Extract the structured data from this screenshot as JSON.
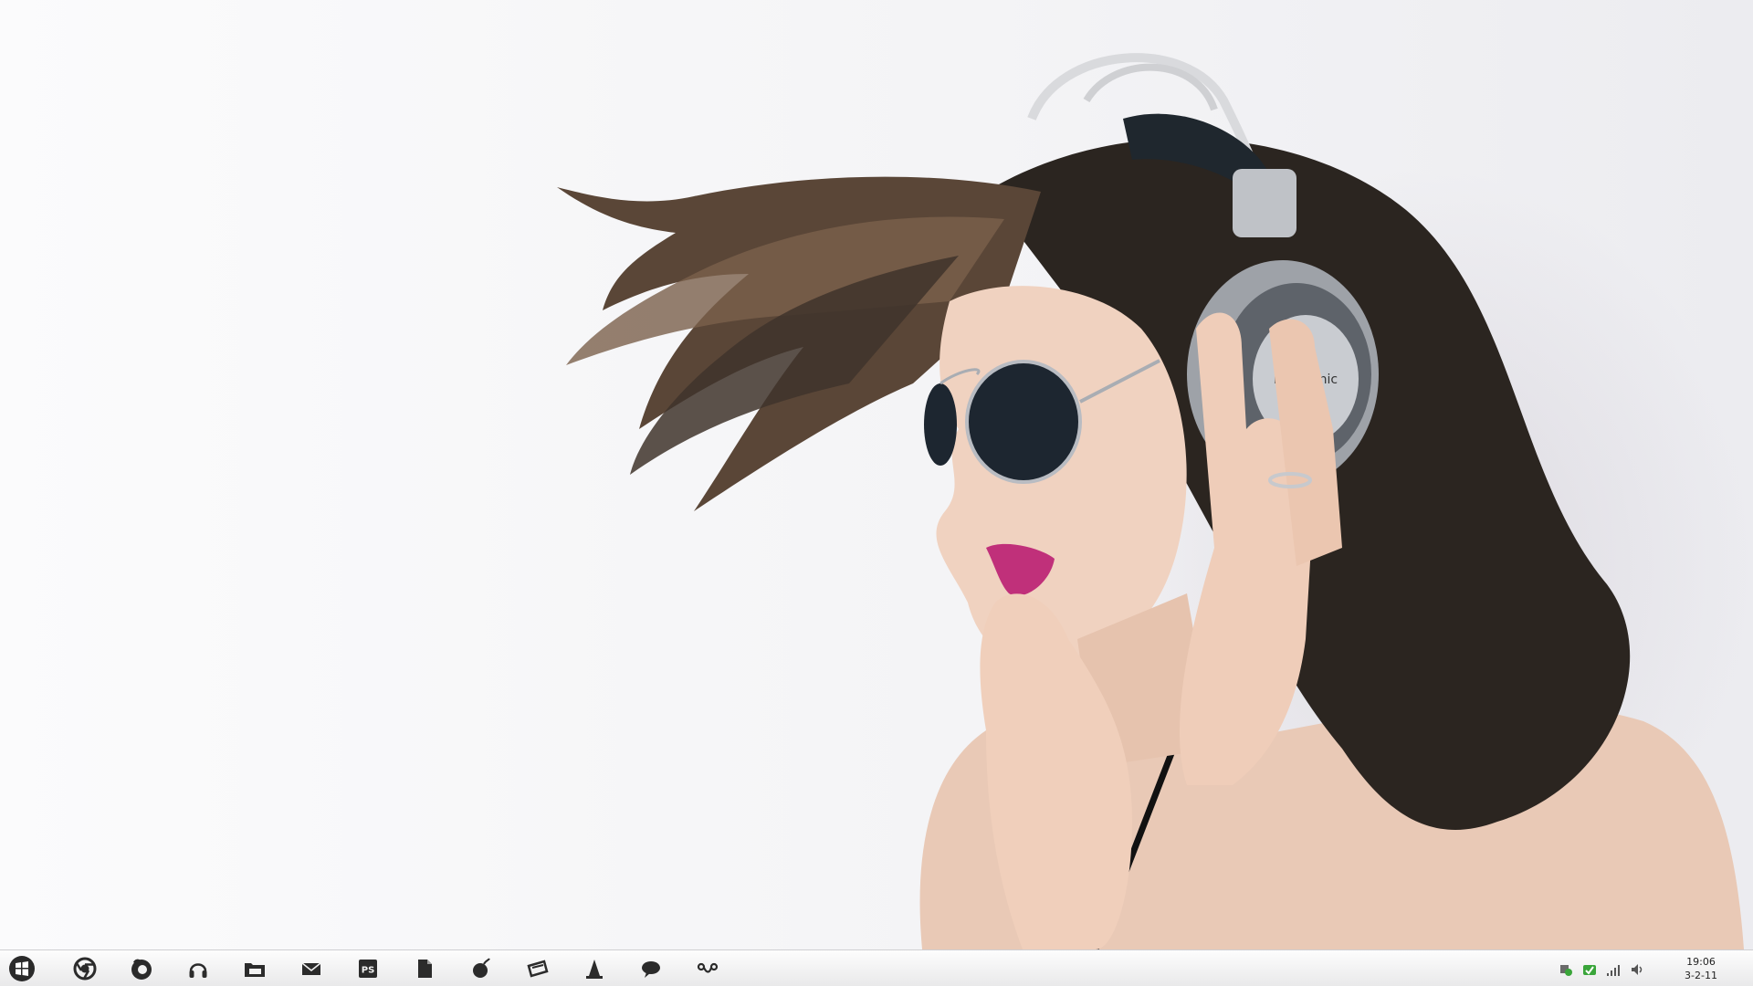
{
  "desktop": {
    "wallpaper": {
      "description_icon": "wallpaper-image",
      "brand_text": "Panasonic"
    }
  },
  "taskbar": {
    "start_icon": "windows-logo-icon",
    "pinned": [
      {
        "name": "chrome-icon"
      },
      {
        "name": "firefox-icon"
      },
      {
        "name": "headphones-icon"
      },
      {
        "name": "folder-icon"
      },
      {
        "name": "mail-icon"
      },
      {
        "name": "photoshop-icon",
        "label": "PS"
      },
      {
        "name": "document-icon"
      },
      {
        "name": "bomb-icon"
      },
      {
        "name": "ticket-icon"
      },
      {
        "name": "vlc-cone-icon"
      },
      {
        "name": "chat-bubble-icon"
      },
      {
        "name": "link-icon"
      }
    ],
    "tray": [
      {
        "name": "security-icon"
      },
      {
        "name": "network-status-icon"
      },
      {
        "name": "signal-icon"
      },
      {
        "name": "volume-icon"
      }
    ],
    "clock": {
      "time": "19:06",
      "date": "3-2-11"
    }
  },
  "colors": {
    "taskbar_top": "#fdfdfd",
    "taskbar_bottom": "#e9e9ea",
    "icon": "#2b2b2b",
    "tray_green": "#3aa53a"
  }
}
